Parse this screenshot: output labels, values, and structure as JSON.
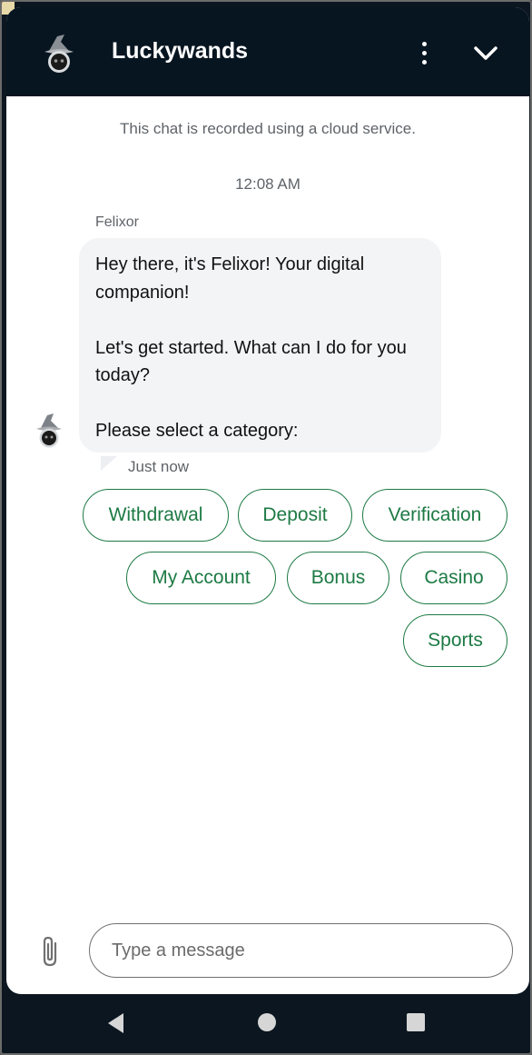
{
  "header": {
    "title": "Luckywands"
  },
  "chat": {
    "notice": "This chat is recorded using a cloud service.",
    "timestamp": "12:08 AM",
    "sender": "Felixor",
    "message": "Hey there, it's Felixor! Your digital companion!\n\nLet's get started. What can I do for you today?\n\nPlease select a category:",
    "status": "Just now"
  },
  "quick_replies": {
    "withdrawal": "Withdrawal",
    "deposit": "Deposit",
    "verification": "Verification",
    "my_account": "My Account",
    "bonus": "Bonus",
    "casino": "Casino",
    "sports": "Sports"
  },
  "composer": {
    "placeholder": "Type a message",
    "value": ""
  },
  "colors": {
    "header_bg": "#071520",
    "chip_accent": "#1d7a44",
    "bubble_bg": "#f3f4f6"
  },
  "icons": {
    "logo": "wizard-hat-logo-icon",
    "menu": "more-vertical-icon",
    "collapse": "chevron-down-icon",
    "attach": "paperclip-icon",
    "back": "back-triangle-icon",
    "home": "home-circle-icon",
    "recents": "recents-square-icon"
  }
}
